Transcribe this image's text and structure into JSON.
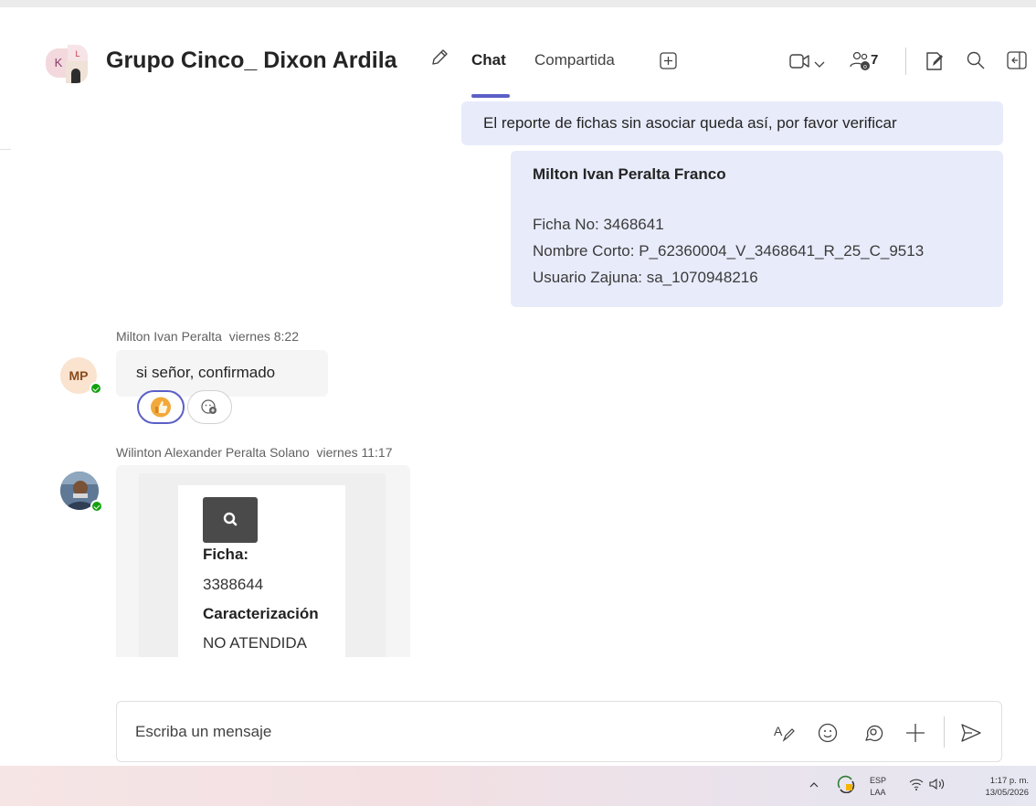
{
  "header": {
    "group_avatar_initials": {
      "left": "K",
      "right": "L"
    },
    "title": "Grupo Cinco_ Dixon Ardila",
    "tabs": [
      {
        "label": "Chat",
        "active": true
      },
      {
        "label": "Compartida",
        "active": false
      }
    ],
    "participants_count": "7",
    "icons": [
      "edit-icon",
      "add-tab-icon",
      "video-call-icon",
      "chevron-down-icon",
      "people-icon",
      "notes-icon",
      "search-icon",
      "side-panel-icon"
    ]
  },
  "messages": {
    "own_1": {
      "text": "El reporte de fichas sin asociar queda así, por favor verificar"
    },
    "own_2": {
      "name": "Milton Ivan Peralta Franco",
      "lines": [
        "Ficha No: 3468641",
        "Nombre Corto: P_62360004_V_3468641_R_25_C_9513",
        "Usuario Zajuna: sa_1070948216"
      ]
    },
    "reply_1": {
      "sender": "Milton Ivan Peralta",
      "time": "viernes 8:22",
      "avatar_initials": "MP",
      "text": "si señor, confirmado",
      "reactions": [
        "like",
        "add-reaction"
      ]
    },
    "reply_2": {
      "sender": "Wilinton Alexander Peralta Solano",
      "time": "viernes 11:17",
      "card": {
        "field1_label": "Ficha:",
        "field1_value": "3388644",
        "field2_label": "Caracterización",
        "field2_value": "NO ATENDIDA"
      }
    }
  },
  "compose": {
    "placeholder": "Escriba un mensaje",
    "icons": [
      "format-icon",
      "emoji-icon",
      "loop-icon",
      "plus-icon",
      "send-icon"
    ]
  },
  "taskbar": {
    "language_top": "ESP",
    "language_bottom": "LAA",
    "time": "1:17 p. m.",
    "date": "13/05/2026"
  },
  "colors": {
    "accent": "#5b5fc7",
    "own_bubble": "#e8ebfa",
    "other_bubble": "#f5f5f5",
    "presence_available": "#13a10e"
  }
}
